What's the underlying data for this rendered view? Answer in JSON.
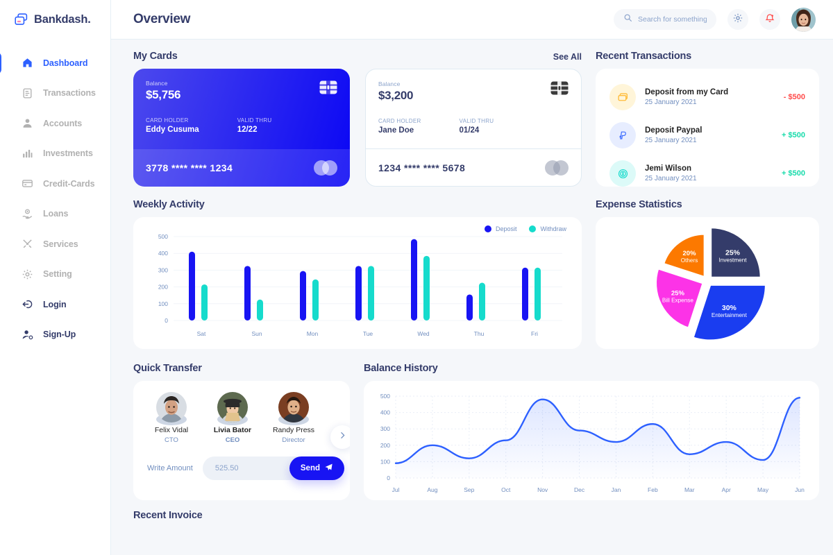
{
  "brand": {
    "name": "Bankdash.",
    "logo_icon": "cards-logo-icon"
  },
  "sidebar": {
    "items": [
      {
        "label": "Dashboard",
        "icon": "home-icon",
        "state": "active"
      },
      {
        "label": "Transactions",
        "icon": "transfer-icon",
        "state": "muted"
      },
      {
        "label": "Accounts",
        "icon": "user-icon",
        "state": "muted"
      },
      {
        "label": "Investments",
        "icon": "bar-chart-icon",
        "state": "muted"
      },
      {
        "label": "Credit-Cards",
        "icon": "credit-card-icon",
        "state": "muted"
      },
      {
        "label": "Loans",
        "icon": "hand-money-icon",
        "state": "muted"
      },
      {
        "label": "Services",
        "icon": "tools-icon",
        "state": "muted"
      },
      {
        "label": "Setting",
        "icon": "gear-icon",
        "state": "muted"
      },
      {
        "label": "Login",
        "icon": "login-arrow-icon",
        "state": "dark"
      },
      {
        "label": "Sign-Up",
        "icon": "user-plus-icon",
        "state": "dark"
      }
    ]
  },
  "header": {
    "title": "Overview",
    "search": {
      "placeholder": "Search for something",
      "value": "",
      "icon": "search-icon"
    },
    "settings_icon": "gear-icon",
    "notifications_icon": "bell-icon",
    "avatar": "user-avatar"
  },
  "my_cards": {
    "title": "My Cards",
    "see_all": "See All",
    "cards": [
      {
        "theme": "blue",
        "balance_label": "Balance",
        "balance": "$5,756",
        "holder_label": "CARD HOLDER",
        "holder": "Eddy Cusuma",
        "valid_label": "VALID THRU",
        "valid": "12/22",
        "number": "3778 **** **** 1234",
        "chip_icon": "emv-chip-icon",
        "network_icon": "mastercard-icon"
      },
      {
        "theme": "white",
        "balance_label": "Balance",
        "balance": "$3,200",
        "holder_label": "CARD HOLDER",
        "holder": "Jane Doe",
        "valid_label": "VALID THRU",
        "valid": "01/24",
        "number": "1234 **** **** 5678",
        "chip_icon": "emv-chip-icon",
        "network_icon": "mastercard-icon"
      }
    ]
  },
  "recent_transactions": {
    "title": "Recent Transactions",
    "items": [
      {
        "title": "Deposit from my Card",
        "date": "25 January 2021",
        "amount": "- $500",
        "sign": "neg",
        "icon": "wallet-card-icon",
        "icon_bg": "#fff5d9",
        "icon_color": "#ffbb38"
      },
      {
        "title": "Deposit Paypal",
        "date": "25 January 2021",
        "amount": "+ $500",
        "sign": "pos",
        "icon": "paypal-icon",
        "icon_bg": "#e7edff",
        "icon_color": "#396aff"
      },
      {
        "title": "Jemi Wilson",
        "date": "25 January 2021",
        "amount": "+ $500",
        "sign": "pos",
        "icon": "dollar-coin-icon",
        "icon_bg": "#dcfaf8",
        "icon_color": "#16dbcc"
      }
    ]
  },
  "weekly_activity": {
    "title": "Weekly Activity"
  },
  "expense_statistics": {
    "title": "Expense Statistics"
  },
  "quick_transfer": {
    "title": "Quick Transfer",
    "people": [
      {
        "name": "Felix Vidal",
        "role": "CTO",
        "selected": false
      },
      {
        "name": "Livia Bator",
        "role": "CEO",
        "selected": true
      },
      {
        "name": "Randy Press",
        "role": "Director",
        "selected": false
      }
    ],
    "next_icon": "chevron-right-icon",
    "amount_label": "Write Amount",
    "amount_placeholder": "525.50",
    "amount_value": "",
    "send_label": "Send",
    "send_icon": "send-plane-icon"
  },
  "balance_history": {
    "title": "Balance History"
  },
  "recent_invoice": {
    "title": "Recent Invoice"
  },
  "colors": {
    "accent": "#2d60ff",
    "deposit": "#1814f3",
    "withdraw": "#16dbcc",
    "title": "#343c6a",
    "muted": "#718ebf",
    "page_bg": "#f5f7fa",
    "positive": "#16dbaa",
    "negative": "#ff4b4a"
  },
  "chart_data": [
    {
      "type": "bar",
      "title": "Weekly Activity",
      "categories": [
        "Sat",
        "Sun",
        "Mon",
        "Tue",
        "Wed",
        "Thu",
        "Fri"
      ],
      "series": [
        {
          "name": "Deposit",
          "color": "#1814f3",
          "values": [
            410,
            325,
            295,
            325,
            485,
            155,
            315
          ]
        },
        {
          "name": "Withdraw",
          "color": "#16dbcc",
          "values": [
            215,
            125,
            245,
            325,
            385,
            225,
            315
          ]
        }
      ],
      "ylabel": "",
      "xlabel": "",
      "ylim": [
        0,
        500
      ],
      "yticks": [
        0,
        100,
        200,
        300,
        400,
        500
      ],
      "grid": true,
      "legend": "top-right"
    },
    {
      "type": "pie",
      "title": "Expense Statistics",
      "exploded": true,
      "slices": [
        {
          "label": "Entertainment",
          "value": 30,
          "display": "30%",
          "color": "#1a3df0"
        },
        {
          "label": "Bill Expense",
          "value": 25,
          "display": "25%",
          "color": "#fc33e7"
        },
        {
          "label": "Investment",
          "value": 25,
          "display": "25%",
          "color": "#343c6a"
        },
        {
          "label": "Others",
          "value": 20,
          "display": "20%",
          "color": "#fc7900"
        }
      ]
    },
    {
      "type": "line",
      "title": "Balance History",
      "x": [
        "Jul",
        "Aug",
        "Sep",
        "Oct",
        "Nov",
        "Dec",
        "Jan",
        "Feb",
        "Mar",
        "Apr",
        "May",
        "Jun"
      ],
      "values": [
        90,
        200,
        120,
        230,
        480,
        290,
        220,
        330,
        145,
        220,
        110,
        490
      ],
      "ylim": [
        0,
        500
      ],
      "yticks": [
        0,
        100,
        200,
        300,
        400,
        500
      ],
      "line_color": "#2d60ff",
      "fill": "rgba(45,96,255,0.08)",
      "grid": true,
      "xlabel": "",
      "ylabel": ""
    }
  ]
}
